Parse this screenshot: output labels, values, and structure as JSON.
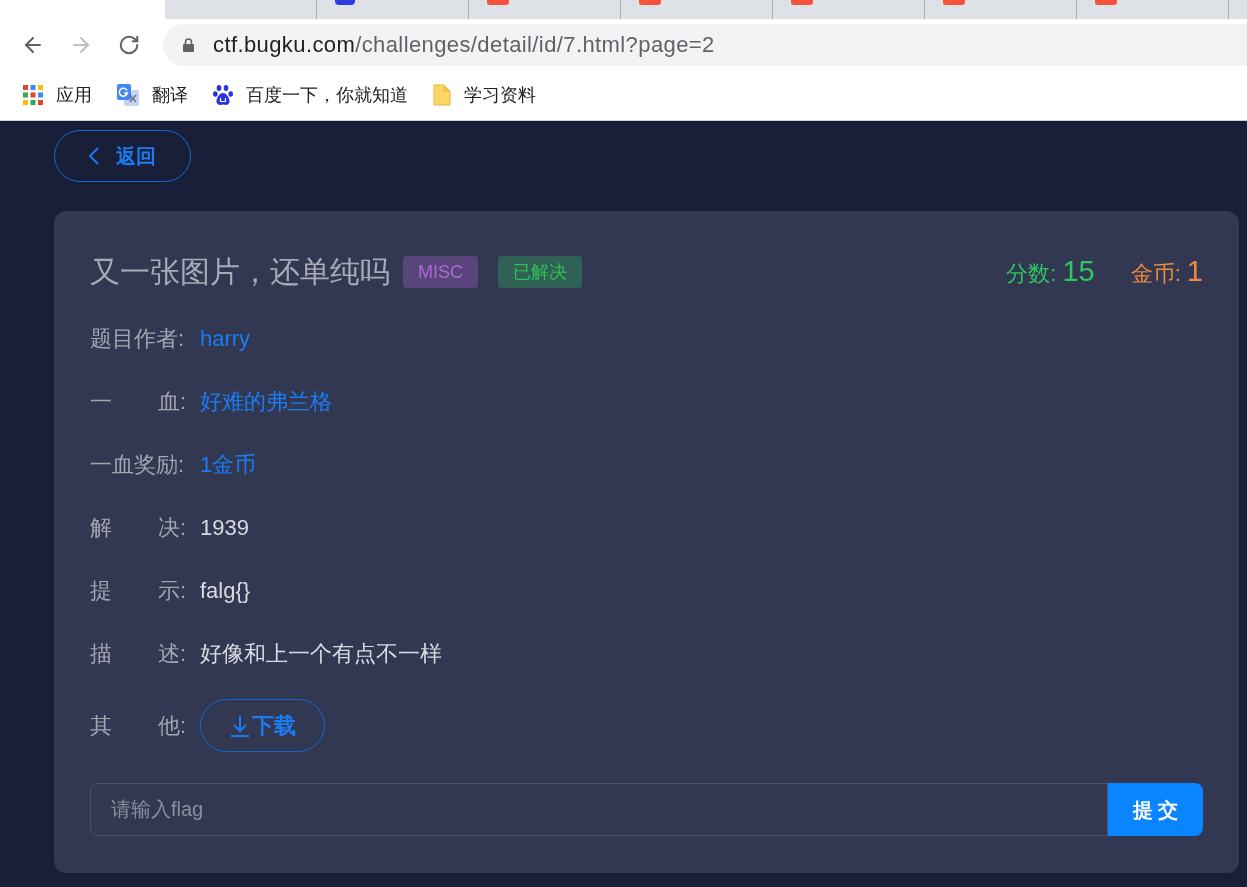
{
  "browser": {
    "tabs": [
      {
        "kind": "plain",
        "selected": true
      },
      {
        "kind": "plain",
        "selected": false
      },
      {
        "kind": "paw",
        "selected": false
      },
      {
        "kind": "tile",
        "selected": false
      },
      {
        "kind": "tile",
        "selected": false
      },
      {
        "kind": "tile",
        "selected": false
      },
      {
        "kind": "tile",
        "selected": false
      },
      {
        "kind": "tile",
        "selected": false
      }
    ],
    "nav_buttons": [
      {
        "kind": "back",
        "disabled": false
      },
      {
        "kind": "forward",
        "disabled": true
      },
      {
        "kind": "reload",
        "disabled": false
      }
    ],
    "url": {
      "host": "ctf.bugku.com",
      "path": "/challenges/detail/id/7.html?page=2"
    },
    "bookmarks": [
      {
        "kind": "apps",
        "label": "应用"
      },
      {
        "kind": "translate",
        "label": "翻译"
      },
      {
        "kind": "paw",
        "label": "百度一下，你就知道"
      },
      {
        "kind": "folder",
        "label": "学习资料"
      }
    ]
  },
  "back_button": {
    "label": "返回"
  },
  "challenge": {
    "title": "又一张图片，还单纯吗",
    "tags": [
      {
        "label": "MISC",
        "color": "#b066d8"
      },
      {
        "label": "已解决",
        "color": "#2fc05a"
      }
    ],
    "stats": [
      {
        "label": "分数:",
        "value": "15",
        "color": "#2ec45f"
      },
      {
        "label": "金币:",
        "value": "1",
        "color": "#f0883e"
      }
    ],
    "fields": [
      {
        "kind": "link",
        "label": "题目作者:",
        "value": "harry"
      },
      {
        "kind": "link",
        "label": "一 血:",
        "value": "好难的弗兰格"
      },
      {
        "kind": "link",
        "label": "一血奖励:",
        "value": "1金币"
      },
      {
        "kind": "text",
        "label": "解 决:",
        "value": "1939"
      },
      {
        "kind": "text",
        "label": "提 示:",
        "value": "falg{}"
      },
      {
        "kind": "text",
        "label": "描 述:",
        "value": "好像和上一个有点不一样"
      },
      {
        "kind": "download",
        "label": "其 他:",
        "value": "下载"
      }
    ],
    "flag_input": {
      "placeholder": "请输入flag"
    },
    "submit_button": {
      "label": "提 交"
    }
  }
}
